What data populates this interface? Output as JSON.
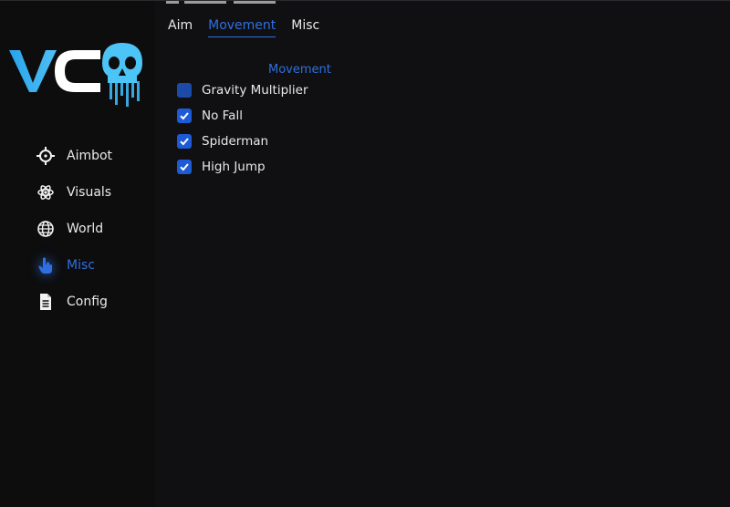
{
  "logo": {
    "text": "VC",
    "icon": "skull-icon"
  },
  "nav": [
    {
      "label": "Aimbot",
      "icon": "crosshair-icon",
      "active": false
    },
    {
      "label": "Visuals",
      "icon": "atom-icon",
      "active": false
    },
    {
      "label": "World",
      "icon": "globe-icon",
      "active": false
    },
    {
      "label": "Misc",
      "icon": "hand-pointer-icon",
      "active": true
    },
    {
      "label": "Config",
      "icon": "document-icon",
      "active": false
    }
  ],
  "tabs": [
    {
      "label": "Aim",
      "active": false
    },
    {
      "label": "Movement",
      "active": true
    },
    {
      "label": "Misc",
      "active": false
    }
  ],
  "section": {
    "title": "Movement"
  },
  "options": [
    {
      "label": "Gravity Multiplier",
      "checked": false
    },
    {
      "label": "No Fall",
      "checked": true
    },
    {
      "label": "Spiderman",
      "checked": true
    },
    {
      "label": "High Jump",
      "checked": true
    }
  ],
  "colors": {
    "accent": "#2f6fe0",
    "checkbox": "#1e5ad6",
    "background": "#101012",
    "text": "#e6e6e6"
  }
}
